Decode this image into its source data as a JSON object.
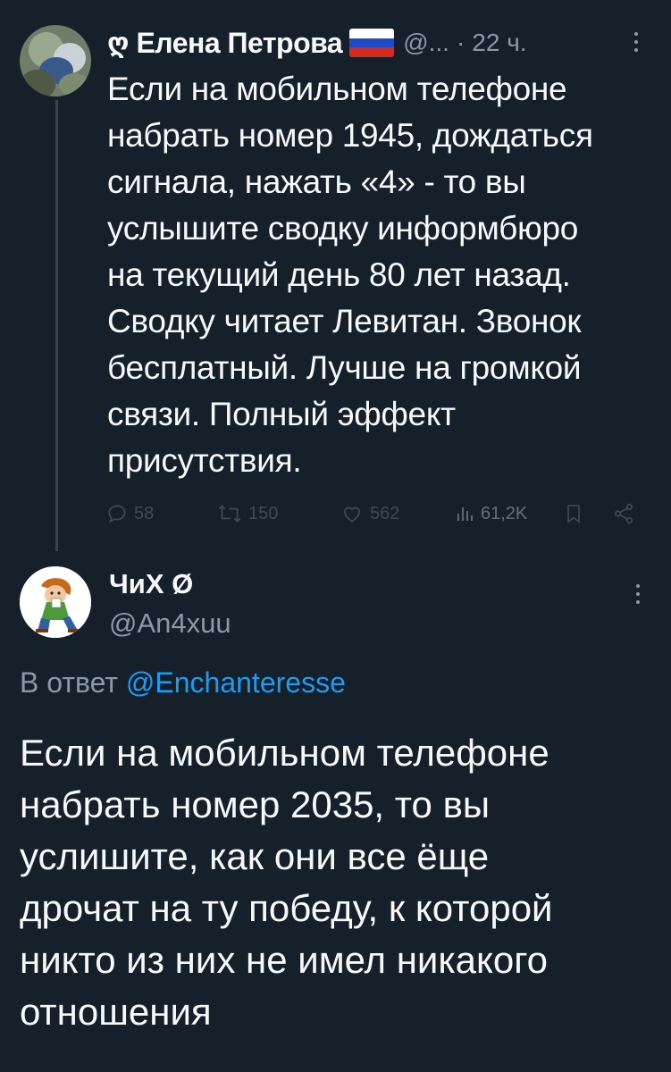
{
  "colors": {
    "background": "#15202b",
    "text": "#f7f9f9",
    "muted": "#8b98a5",
    "link": "#1d9bf0",
    "thread_line": "#38444d"
  },
  "parent_tweet": {
    "badge_icon": "quote-badge-icon",
    "display_name": "Елена Петрова",
    "flag_icon": "russia-flag-icon",
    "handle_truncated": "@...",
    "separator": "·",
    "time": "22 ч.",
    "text_lines": [
      "Если на мобильном телефоне",
      "набрать номер 1945, дождаться",
      "сигнала, нажать «4» - то вы",
      "услышите сводку информбюро",
      "на текущий день 80 лет назад.",
      "Сводку читает Левитан. Звонок",
      "бесплатный. Лучше на громкой",
      "связи. Полный эффект",
      "присутствия."
    ],
    "actions": {
      "replies": "58",
      "retweets": "150",
      "likes": "562",
      "views": "61,2K"
    }
  },
  "reply_tweet": {
    "display_name": "ЧиХ Ø",
    "handle": "@An4xuu",
    "reply_prefix": "В ответ ",
    "reply_to": "@Enchanteresse",
    "text_lines": [
      "Если на мобильном телефоне",
      "набрать номер 2035, то вы",
      "услишите, как они все ёще",
      "дрочат на ту победу, к которой",
      "никто из них не имел никакого",
      "отношения"
    ]
  }
}
